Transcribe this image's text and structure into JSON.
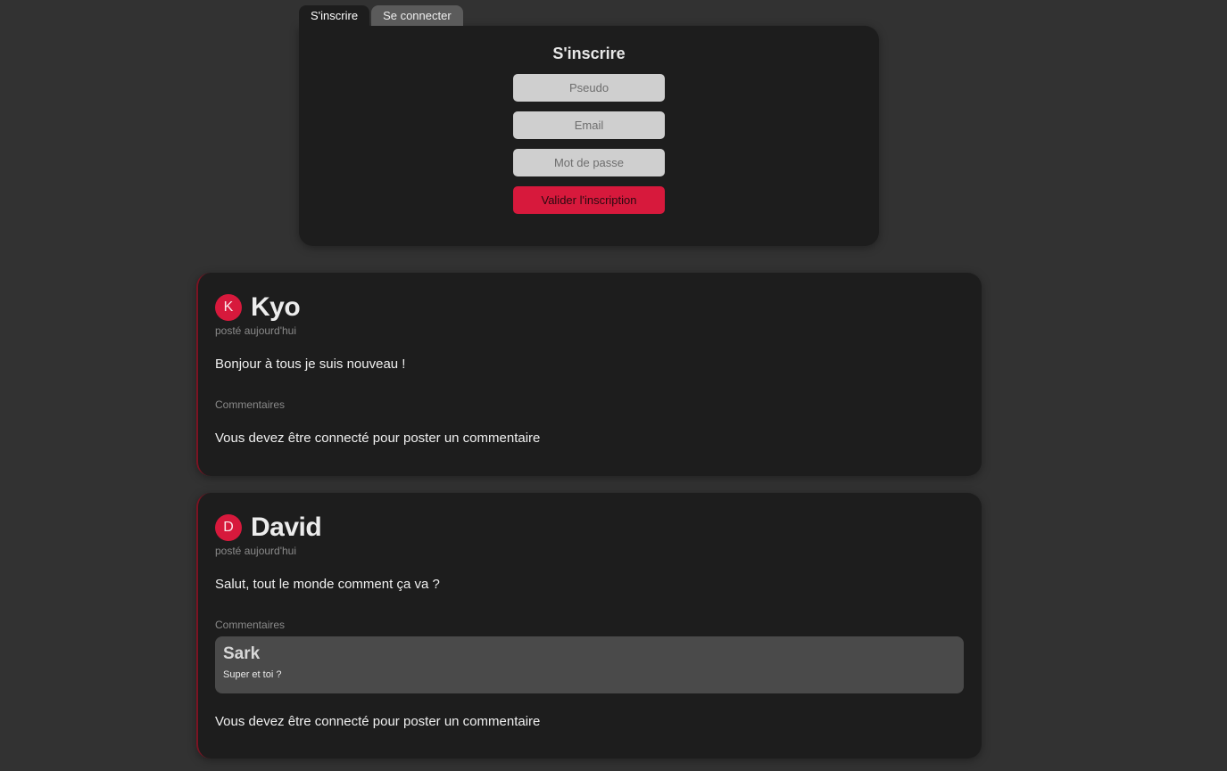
{
  "auth": {
    "tabs": [
      {
        "label": "S'inscrire",
        "active": true
      },
      {
        "label": "Se connecter",
        "active": false
      }
    ],
    "title": "S'inscrire",
    "fields": {
      "pseudo_placeholder": "Pseudo",
      "email_placeholder": "Email",
      "password_placeholder": "Mot de passe"
    },
    "submit_label": "Valider l'inscription"
  },
  "posts": [
    {
      "avatar_letter": "K",
      "author": "Kyo",
      "posted": "posté aujourd'hui",
      "content": "Bonjour à tous je suis nouveau !",
      "comments_label": "Commentaires",
      "comments": [],
      "login_note": "Vous devez être connecté pour poster un commentaire"
    },
    {
      "avatar_letter": "D",
      "author": "David",
      "posted": "posté aujourd'hui",
      "content": "Salut, tout le monde comment ça va ?",
      "comments_label": "Commentaires",
      "comments": [
        {
          "author": "Sark",
          "text": "Super et toi ?"
        }
      ],
      "login_note": "Vous devez être connecté pour poster un commentaire"
    }
  ],
  "colors": {
    "accent": "#d7193c",
    "background": "#323232",
    "card": "#1d1d1d",
    "comment_bg": "#4a4a4a"
  }
}
